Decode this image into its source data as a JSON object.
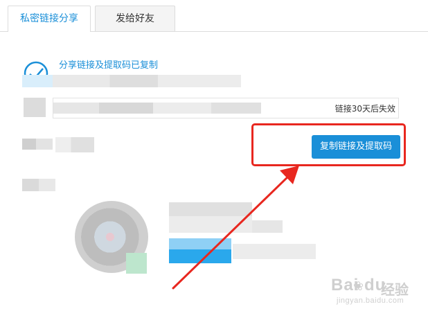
{
  "tabs": [
    {
      "label": "私密链接分享",
      "active": true
    },
    {
      "label": "发给好友",
      "active": false
    }
  ],
  "success": {
    "message": "分享链接及提取码已复制",
    "icon": "check-circle-icon"
  },
  "link": {
    "expire_text": "链接30天后失效"
  },
  "actions": {
    "copy_label": "复制链接及提取码"
  },
  "annotation": {
    "box_color": "#e8271f",
    "arrow_color": "#e8271f"
  },
  "colors": {
    "accent": "#1a8fd8",
    "tab_border": "#dcdcdc"
  },
  "watermark": {
    "brand": "Bai du",
    "jingyan": "经验",
    "url": "jingyan.baidu.com"
  }
}
